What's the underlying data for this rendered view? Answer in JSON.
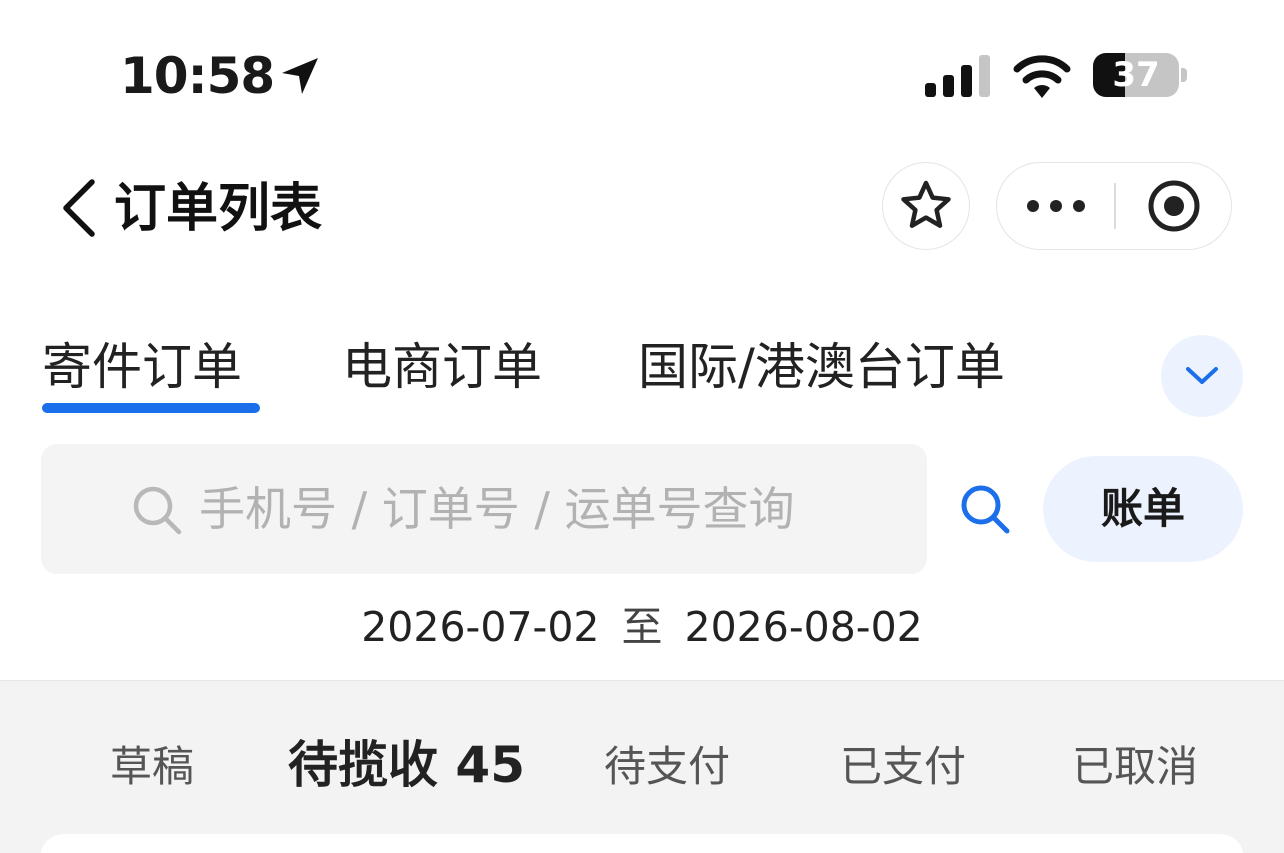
{
  "status_bar": {
    "time": "10:58",
    "battery_level": 37,
    "battery_text": "37",
    "icons": [
      "location-arrow-icon",
      "cellular-signal-icon",
      "wifi-icon",
      "battery-icon"
    ]
  },
  "nav": {
    "title": "订单列表",
    "icons": [
      "back-chevron-icon",
      "star-icon",
      "more-dots-icon",
      "close-target-icon"
    ]
  },
  "tabs": {
    "items": [
      {
        "label": "寄件订单",
        "active": true
      },
      {
        "label": "电商订单",
        "active": false
      },
      {
        "label": "国际/港澳台订单",
        "active": false
      }
    ],
    "accent_color": "#1c6fea",
    "expand_icon": "chevron-down-icon"
  },
  "search": {
    "placeholder": "手机号 / 订单号 / 运单号查询",
    "bill_label": "账单"
  },
  "date_range": {
    "start": "2026-07-02",
    "separator": "至",
    "end": "2026-08-02"
  },
  "status_filters": [
    {
      "label": "草稿",
      "active": false
    },
    {
      "label": "待揽收 45",
      "active": true
    },
    {
      "label": "待支付",
      "active": false
    },
    {
      "label": "已支付",
      "active": false
    },
    {
      "label": "已取消",
      "active": false
    }
  ]
}
